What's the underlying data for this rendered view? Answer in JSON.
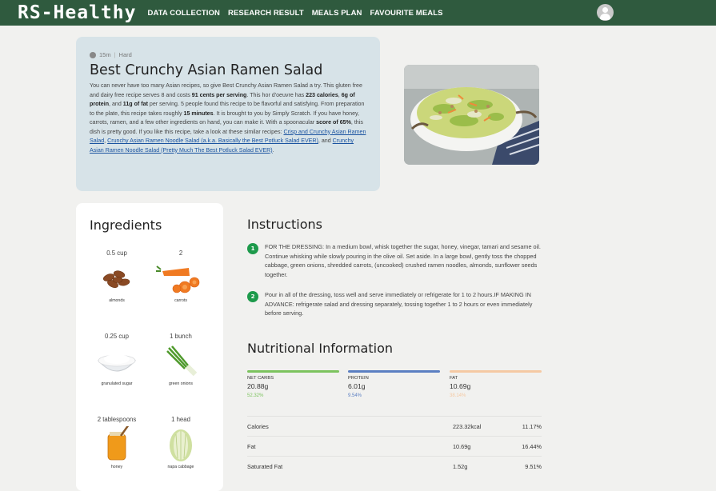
{
  "nav": {
    "brand": "RS-Healthy",
    "links": [
      "DATA COLLECTION",
      "RESEARCH RESULT",
      "MEALS PLAN",
      "FAVOURITE MEALS"
    ]
  },
  "recipe": {
    "time": "15m",
    "difficulty": "Hard",
    "title": "Best Crunchy Asian Ramen Salad",
    "desc_1": "You can never have too many Asian recipes, so give Best Crunchy Asian Ramen Salad a try. This gluten free and dairy free recipe serves 8 and costs ",
    "desc_cost": "91 cents per serving",
    "desc_2": ". This hor d'oeuvre has ",
    "desc_calories": "223 calories",
    "desc_3": ", ",
    "desc_protein": "6g of protein",
    "desc_4": ", and ",
    "desc_fat": "11g of fat",
    "desc_5": " per serving. 5 people found this recipe to be flavorful and satisfying. From preparation to the plate, this recipe takes roughly ",
    "desc_time": "15 minutes",
    "desc_6": ". It is brought to you by Simply Scratch. If you have honey, carrots, ramen, and a few other ingredients on hand, you can make it. With a spoonacular ",
    "desc_score": "score of 65%",
    "desc_7": ", this dish is pretty good. If you like this recipe, take a look at these similar recipes: ",
    "link_1": "Crisp and Crunchy Asian Ramen Salad",
    "desc_8": ", ",
    "link_2": "Crunchy Asian Ramen Noodle Salad (a.k.a. Basically the Best Potluck Salad EVER)",
    "desc_9": ", and ",
    "link_3": "Crunchy Asian Ramen Noodle Salad (Pretty Much The Best Potluck Salad EVER)",
    "desc_10": "."
  },
  "ingredients": {
    "title": "Ingredients",
    "items": [
      {
        "qty": "0.5 cup",
        "name": "almonds"
      },
      {
        "qty": "2",
        "name": "carrots"
      },
      {
        "qty": "0.25 cup",
        "name": "granulated sugar"
      },
      {
        "qty": "1 bunch",
        "name": "green onions"
      },
      {
        "qty": "2 tablespoons",
        "name": "honey"
      },
      {
        "qty": "1 head",
        "name": "napa cabbage"
      }
    ]
  },
  "instructions": {
    "title": "Instructions",
    "steps": [
      {
        "num": "1",
        "text": "FOR THE DRESSING: In a medium bowl, whisk together the sugar, honey, vinegar, tamari and sesame oil. Continue whisking while slowly pouring in the olive oil. Set aside. In a large bowl, gently toss the chopped cabbage, green onions, shredded carrots, (uncooked) crushed ramen noodles, almonds, sunflower seeds together."
      },
      {
        "num": "2",
        "text": "Pour in all of the dressing, toss well and serve immediately or refrigerate for 1 to 2 hours.IF MAKING IN ADVANCE: refrigerate salad and dressing separately, tossing together 1 to 2 hours or even immediately before serving."
      }
    ]
  },
  "nutrition": {
    "title": "Nutritional Information",
    "macros": [
      {
        "label": "NET CARBS",
        "value": "20.88g",
        "percent": "52.32%",
        "color": "#7cc35e"
      },
      {
        "label": "PROTEIN",
        "value": "6.01g",
        "percent": "9.54%",
        "color": "#5b7fc2"
      },
      {
        "label": "FAT",
        "value": "10.69g",
        "percent": "38.14%",
        "color": "#f5c9a3"
      }
    ],
    "rows": [
      {
        "name": "Calories",
        "amount": "223.32kcal",
        "percent": "11.17%"
      },
      {
        "name": "Fat",
        "amount": "10.69g",
        "percent": "16.44%"
      },
      {
        "name": "Saturated Fat",
        "amount": "1.52g",
        "percent": "9.51%"
      }
    ]
  },
  "icons": {
    "user": "user-avatar-icon",
    "clock": "clock-icon"
  }
}
